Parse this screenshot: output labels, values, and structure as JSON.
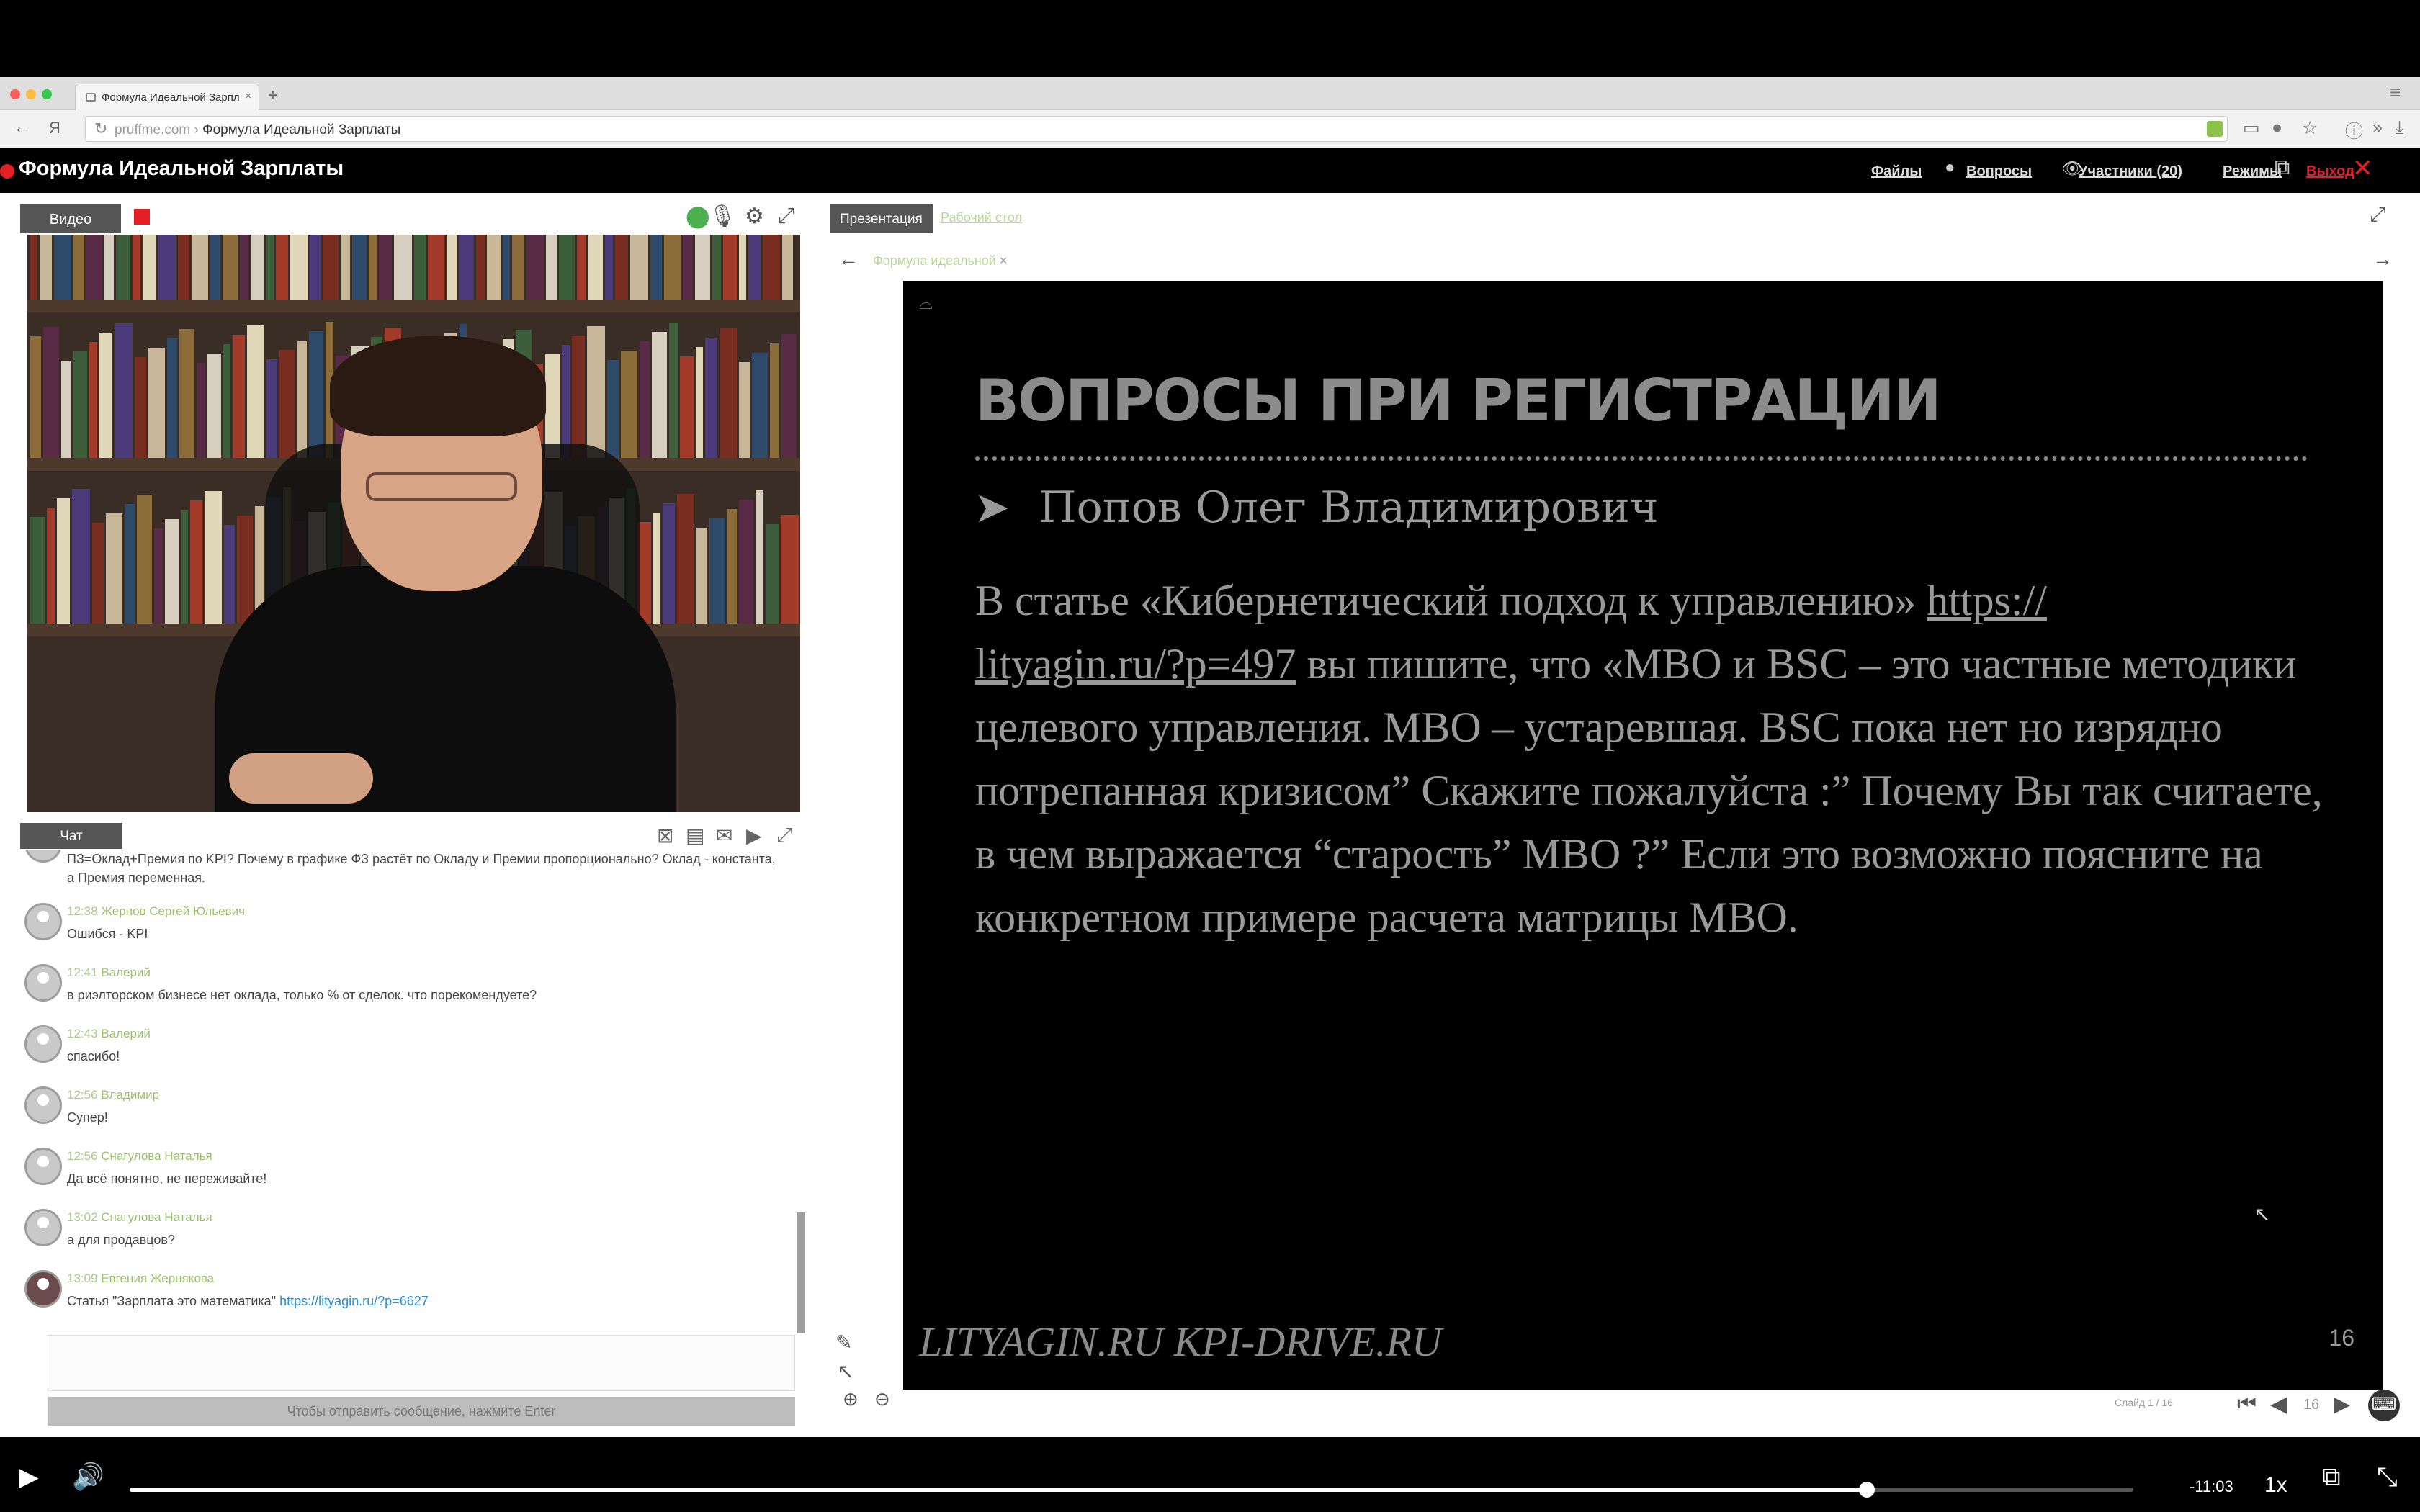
{
  "browser": {
    "tab_title": "Формула Идеальной Зарпл",
    "new_tab": "+",
    "url_host": "pruffme.com",
    "url_separator": "›",
    "url_path": "Формула Идеальной Зарплаты"
  },
  "header": {
    "title": "Формула Идеальной Зарплаты",
    "links": {
      "files": "Файлы",
      "questions": "Вопросы",
      "participants": "Участники (20)",
      "modes": "Режимы",
      "exit": "Выход"
    }
  },
  "video": {
    "tab": "Видео"
  },
  "chat": {
    "tab": "Чат",
    "messages": [
      {
        "time": "",
        "author": "",
        "text": "ПЗ=Оклад+Премия по KPI? Почему в графике ФЗ растёт по Окладу и Премии пропорционально? Оклад - константа,",
        "text2": "а Премия переменная."
      },
      {
        "time": "12:38",
        "author": "Жернов Сергей Юльевич",
        "text": "Ошибся - KPI"
      },
      {
        "time": "12:41",
        "author": "Валерий",
        "text": "в риэлторском бизнесе нет оклада, только % от сделок. что порекомендуете?"
      },
      {
        "time": "12:43",
        "author": "Валерий",
        "text": "спасибо!"
      },
      {
        "time": "12:56",
        "author": "Владимир",
        "text": "Супер!"
      },
      {
        "time": "12:56",
        "author": "Снагулова Наталья",
        "text": "Да всё понятно, не переживайте!"
      },
      {
        "time": "13:02",
        "author": "Снагулова Наталья",
        "text": "а для продавцов?"
      },
      {
        "time": "13:09",
        "author": "Евгения Жернякова",
        "text": "Статья \"Зарплата это математика\"",
        "link": "https://lityagin.ru/?p=6627"
      }
    ],
    "send_hint": "Чтобы отправить сообщение, нажмите Enter"
  },
  "presentation": {
    "tab": "Презентация",
    "desktop_tab": "Рабочий стол",
    "file_tab": "Формула идеальной",
    "slide": {
      "title": "ВОПРОСЫ ПРИ РЕГИСТРАЦИИ",
      "bullet": "Попов Олег Владимирович",
      "body_1": "В статье «Кибернетический подход к управлению» ",
      "link_a": "https://",
      "link_b": "lityagin.ru/?p=497",
      "body_2": "  вы пишите, что «MBO и BSC – это частные методики целевого управления. MBO – устаревшая. BSC пока нет но изрядно потрепанная кризисом” Скажите пожалуйста :” Почему Вы так считаете, в чем выражается “старость” MBO ?” Если это возможно поясните на конкретном примере расчета матрицы MBO.",
      "footer": "LITYAGIN.RU  KPI-DRIVE.RU",
      "page": "16"
    },
    "pager": {
      "label": "Слайд 1 / 16",
      "current": "16"
    }
  },
  "player": {
    "time": "-11:03",
    "speed": "1x",
    "progress": 0.867
  }
}
